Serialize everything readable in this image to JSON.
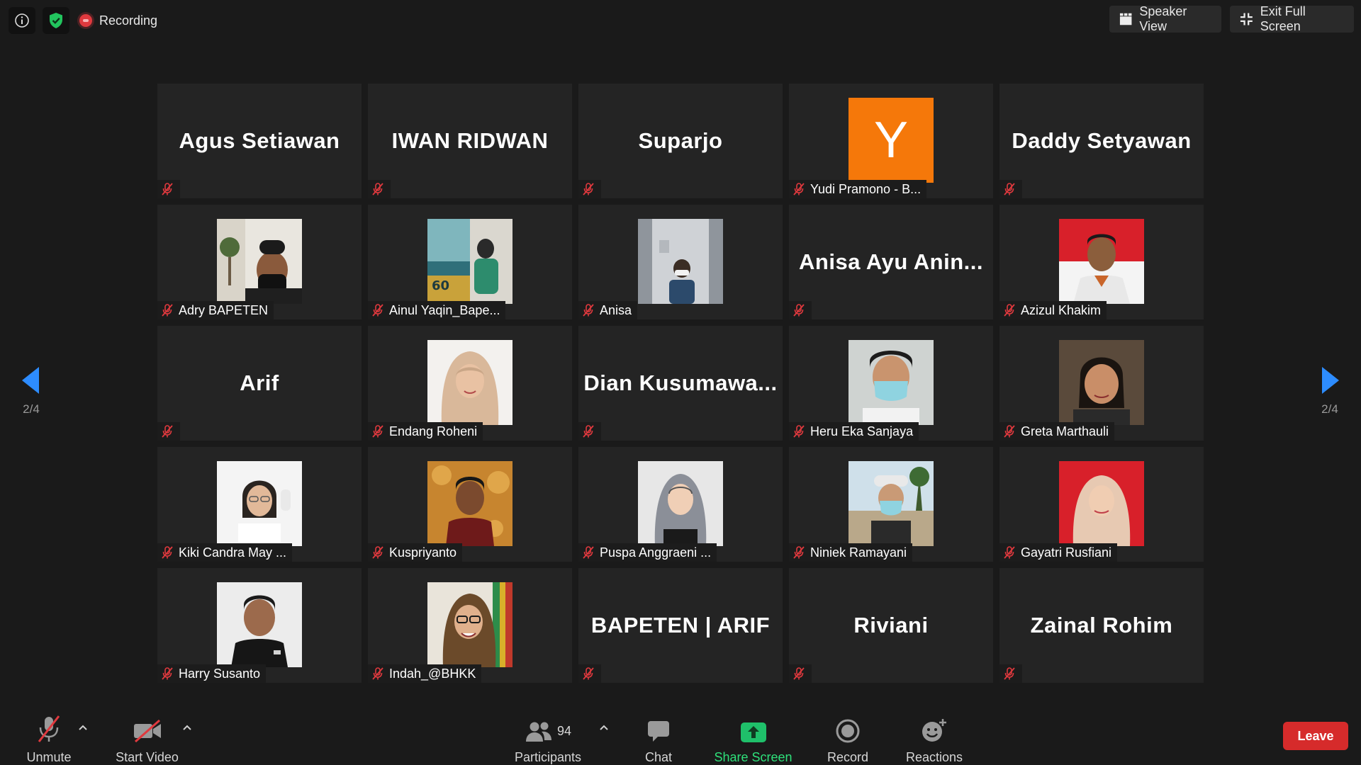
{
  "topbar": {
    "recording_label": "Recording",
    "speaker_view_label": "Speaker View",
    "exit_fullscreen_label": "Exit Full Screen"
  },
  "pagination": {
    "left_indicator": "2/4",
    "right_indicator": "2/4"
  },
  "tiles": [
    {
      "name": "Agus Setiawan",
      "label": ""
    },
    {
      "name": "IWAN RIDWAN",
      "label": ""
    },
    {
      "name": "Suparjo",
      "label": ""
    },
    {
      "name": "",
      "label": "Yudi Pramono - B...",
      "avatar_letter": "Y"
    },
    {
      "name": "Daddy Setyawan",
      "label": ""
    },
    {
      "name": "",
      "label": "Adry BAPETEN"
    },
    {
      "name": "",
      "label": "Ainul Yaqin_Bape..."
    },
    {
      "name": "",
      "label": "Anisa"
    },
    {
      "name": "Anisa Ayu Anin...",
      "label": ""
    },
    {
      "name": "",
      "label": "Azizul Khakim"
    },
    {
      "name": "Arif",
      "label": ""
    },
    {
      "name": "",
      "label": "Endang Roheni"
    },
    {
      "name": "Dian  Kusumawa...",
      "label": ""
    },
    {
      "name": "",
      "label": "Heru Eka Sanjaya"
    },
    {
      "name": "",
      "label": "Greta Marthauli"
    },
    {
      "name": "",
      "label": "Kiki Candra May ..."
    },
    {
      "name": "",
      "label": "Kuspriyanto"
    },
    {
      "name": "",
      "label": "Puspa Anggraeni ..."
    },
    {
      "name": "",
      "label": "Niniek Ramayani"
    },
    {
      "name": "",
      "label": "Gayatri Rusfiani"
    },
    {
      "name": "",
      "label": "Harry Susanto"
    },
    {
      "name": "",
      "label": "Indah_@BHKK"
    },
    {
      "name": "BAPETEN | ARIF",
      "label": ""
    },
    {
      "name": "Riviani",
      "label": ""
    },
    {
      "name": "Zainal Rohim",
      "label": ""
    }
  ],
  "toolbar": {
    "unmute_label": "Unmute",
    "start_video_label": "Start Video",
    "participants_label": "Participants",
    "participants_count": "94",
    "chat_label": "Chat",
    "share_screen_label": "Share Screen",
    "record_label": "Record",
    "reactions_label": "Reactions",
    "leave_label": "Leave"
  },
  "colors": {
    "background": "#1a1a1a",
    "tile": "#242424",
    "share_green": "#2ee07a",
    "leave_red": "#d62b2b",
    "arrow_blue": "#2d8cff",
    "mute_red": "#e0393e",
    "avatar_orange": "#f5780a"
  }
}
